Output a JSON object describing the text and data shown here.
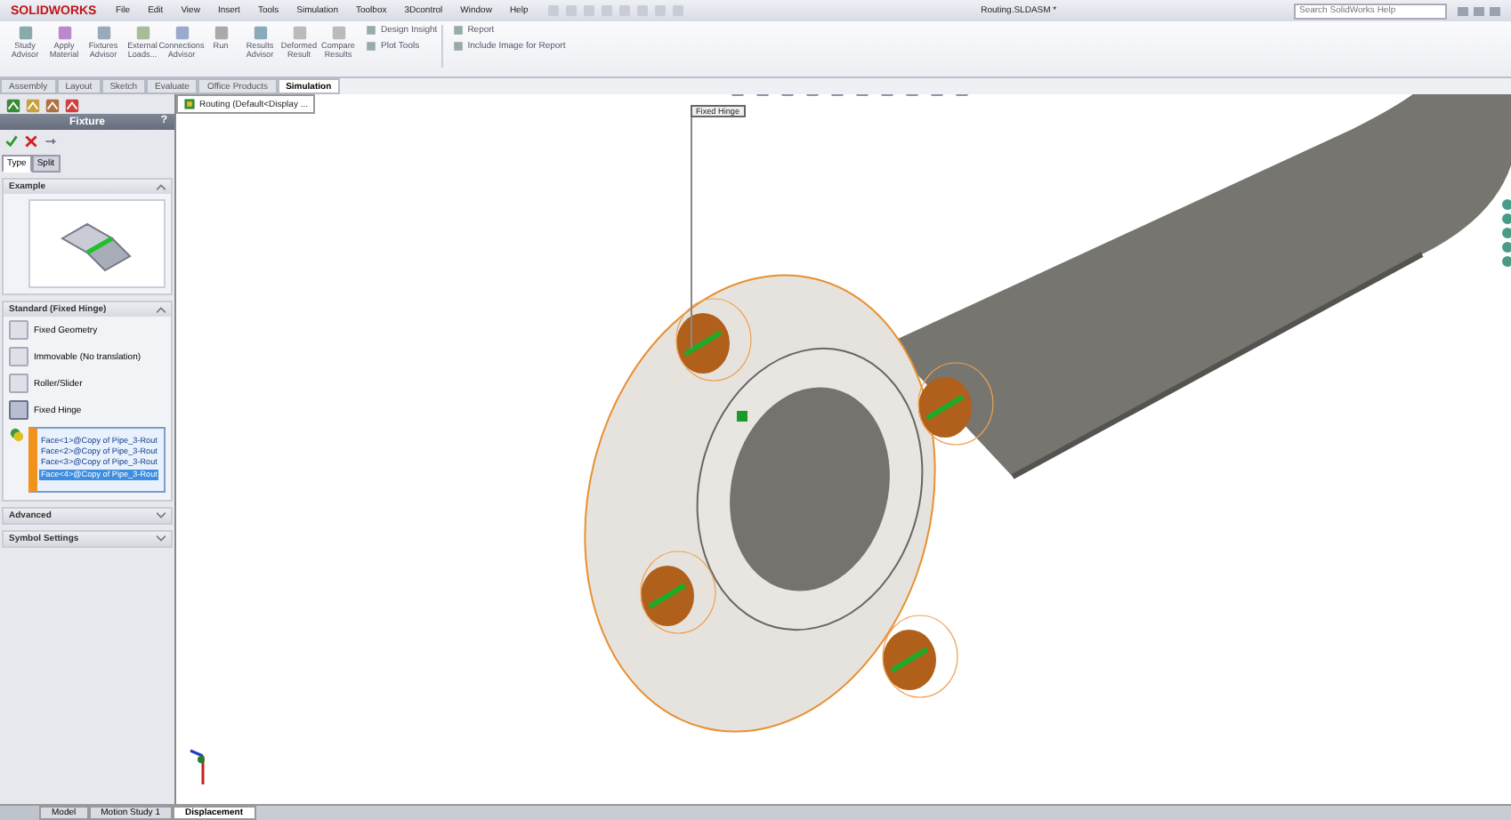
{
  "app": {
    "logo": "SOLIDWORKS",
    "menu": [
      "File",
      "Edit",
      "View",
      "Insert",
      "Tools",
      "Simulation",
      "Toolbox",
      "3Dcontrol",
      "Window",
      "Help"
    ],
    "document_title": "Routing.SLDASM *",
    "search": {
      "placeholder": "Search SolidWorks Help"
    }
  },
  "ribbon": {
    "large_buttons": [
      {
        "label": "Study Advisor"
      },
      {
        "label": "Apply Material"
      },
      {
        "label": "Fixtures Advisor"
      },
      {
        "label": "External Loads..."
      },
      {
        "label": "Connections Advisor"
      },
      {
        "label": "Run"
      },
      {
        "label": "Results Advisor"
      },
      {
        "label": "Deformed Result"
      },
      {
        "label": "Compare Results"
      }
    ],
    "small_buttons": [
      {
        "label": "Design Insight"
      },
      {
        "label": "Plot Tools"
      },
      {
        "label": "Report"
      },
      {
        "label": "Include Image for Report"
      }
    ]
  },
  "command_tabs": [
    {
      "label": "Assembly",
      "selected": false
    },
    {
      "label": "Layout",
      "selected": false
    },
    {
      "label": "Sketch",
      "selected": false
    },
    {
      "label": "Evaluate",
      "selected": false
    },
    {
      "label": "Office Products",
      "selected": false
    },
    {
      "label": "Simulation",
      "selected": true
    }
  ],
  "feature_tree": {
    "root": "Routing  (Default<Display ..."
  },
  "property_manager": {
    "title": "Fixture",
    "help": "?",
    "tabs": [
      {
        "label": "Type",
        "selected": true
      },
      {
        "label": "Split",
        "selected": false
      }
    ],
    "example": {
      "title": "Example"
    },
    "standard": {
      "title": "Standard (Fixed Hinge)",
      "options": [
        {
          "label": "Fixed Geometry",
          "selected": false
        },
        {
          "label": "Immovable (No translation)",
          "selected": false
        },
        {
          "label": "Roller/Slider",
          "selected": false
        },
        {
          "label": "Fixed Hinge",
          "selected": true
        }
      ],
      "faces": [
        {
          "label": "Face<1>@Copy of Pipe_3-Rout",
          "selected": false
        },
        {
          "label": "Face<2>@Copy of Pipe_3-Rout",
          "selected": false
        },
        {
          "label": "Face<3>@Copy of Pipe_3-Rout",
          "selected": false
        },
        {
          "label": "Face<4>@Copy of Pipe_3-Rout",
          "selected": true
        }
      ]
    },
    "collapsed_sections": [
      {
        "title": "Advanced"
      },
      {
        "title": "Symbol Settings"
      }
    ]
  },
  "viewport": {
    "callout": "Fixed Hinge"
  },
  "bottom_tabs": [
    {
      "label": "Model",
      "selected": false
    },
    {
      "label": "Motion Study 1",
      "selected": false
    },
    {
      "label": "Displacement",
      "selected": true
    }
  ]
}
